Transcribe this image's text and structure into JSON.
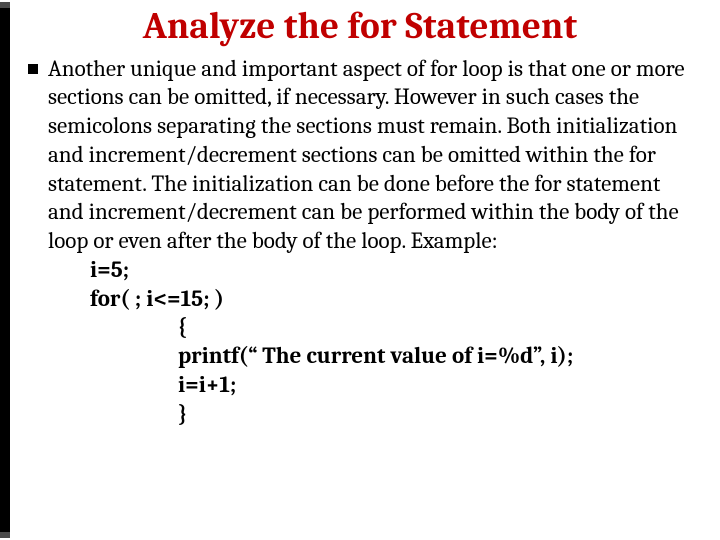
{
  "title": "Analyze the for Statement",
  "bullet": {
    "para": "Another unique and important aspect of for loop is that one or more sections can be omitted, if necessary. However in such cases the semicolons separating the sections must remain. Both initialization and increment/decrement sections can be omitted within the for statement. The initialization can be done  before the for statement and  increment/decrement can be performed within the body of the loop or even after the body of the loop. Example:"
  },
  "code": {
    "l1": "i=5;",
    "l2": "for(   ; i<=15;   )",
    "l3": "{",
    "l4": "printf(“ The current value of i=%d”, i);",
    "l5": "i=i+1;",
    "l6": "}"
  }
}
